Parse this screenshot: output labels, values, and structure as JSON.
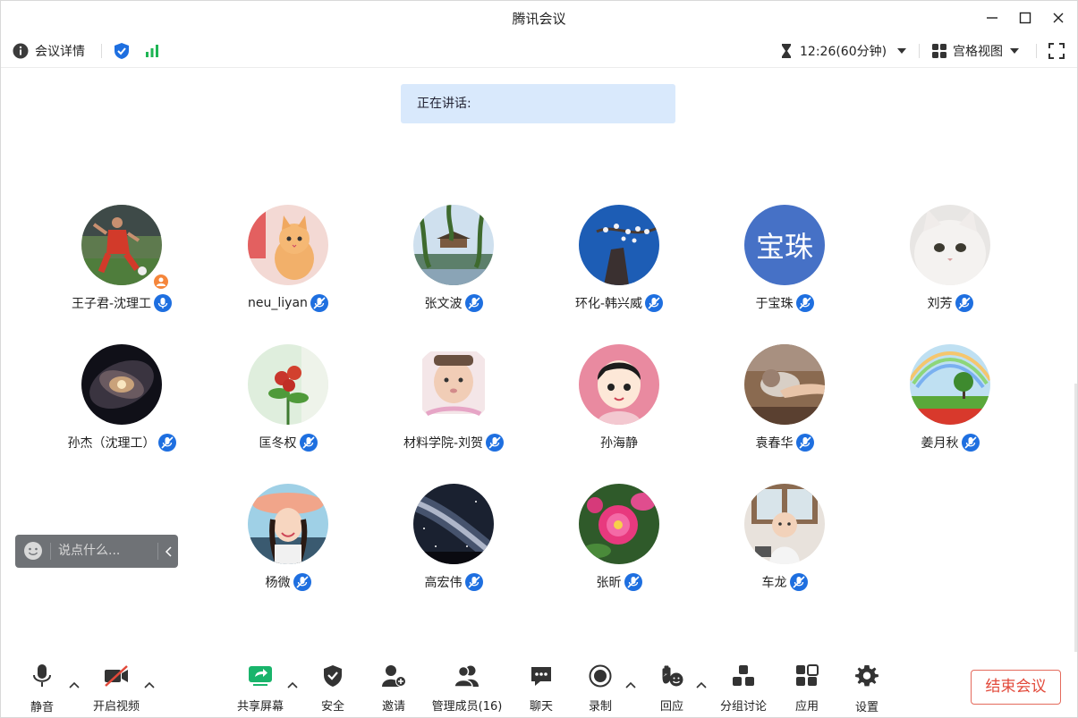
{
  "window": {
    "title": "腾讯会议"
  },
  "topbar": {
    "meeting_info": "会议详情",
    "timer": "12:26(60分钟)",
    "view_mode": "宫格视图"
  },
  "speaking": {
    "label": "正在讲话:"
  },
  "participants": [
    {
      "name": "王子君-沈理工",
      "avatar": "photo-soccer",
      "mic": "active",
      "host": true
    },
    {
      "name": "neu_liyan",
      "avatar": "photo-kitten",
      "mic": "muted"
    },
    {
      "name": "张文波",
      "avatar": "photo-willow-pavilion",
      "mic": "muted"
    },
    {
      "name": "环化-韩兴威",
      "avatar": "photo-blossom-tower",
      "mic": "muted"
    },
    {
      "name": "于宝珠",
      "avatar": "text",
      "avatar_text": "宝珠",
      "mic": "muted"
    },
    {
      "name": "刘芳",
      "avatar": "photo-white-cat",
      "mic": "muted"
    },
    {
      "name": "孙杰（沈理工）",
      "avatar": "photo-galaxy",
      "mic": "muted"
    },
    {
      "name": "匡冬权",
      "avatar": "photo-flowers",
      "mic": "muted"
    },
    {
      "name": "材料学院-刘贺",
      "avatar": "photo-baby",
      "mic": "muted"
    },
    {
      "name": "孙海静",
      "avatar": "cartoon-girl",
      "mic": "none"
    },
    {
      "name": "袁春华",
      "avatar": "photo-cat-hand",
      "mic": "muted"
    },
    {
      "name": "姜月秋",
      "avatar": "photo-rainbow-tree",
      "mic": "muted"
    },
    {
      "name": "杨微",
      "avatar": "photo-woman-hat",
      "mic": "muted"
    },
    {
      "name": "高宏伟",
      "avatar": "photo-milky-way",
      "mic": "muted"
    },
    {
      "name": "张昕",
      "avatar": "photo-pink-flower",
      "mic": "muted"
    },
    {
      "name": "车龙",
      "avatar": "photo-baby-2",
      "mic": "muted"
    }
  ],
  "chat": {
    "placeholder": "说点什么..."
  },
  "bottombar": {
    "mute": "静音",
    "video": "开启视频",
    "share": "共享屏幕",
    "security": "安全",
    "invite": "邀请",
    "members": "管理成员(16)",
    "chat": "聊天",
    "record": "录制",
    "react": "回应",
    "breakout": "分组讨论",
    "apps": "应用",
    "settings": "设置",
    "end": "结束会议"
  },
  "colors": {
    "accent": "#1e6fe0",
    "share_green": "#19b46b",
    "end_red": "#e2493a",
    "signal_green": "#1fb554"
  }
}
